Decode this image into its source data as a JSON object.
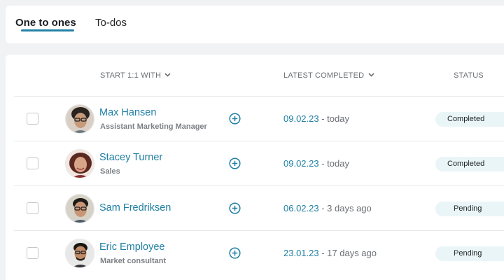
{
  "tabs": [
    {
      "label": "One to ones",
      "active": true
    },
    {
      "label": "To-dos",
      "active": false
    }
  ],
  "table": {
    "headers": {
      "start_with": "START 1:1 WITH",
      "latest_completed": "LATEST COMPLETED",
      "status": "STATUS"
    },
    "rows": [
      {
        "name": "Max Hansen",
        "role": "Assistant Marketing Manager",
        "date": "09.02.23",
        "relative": " - today",
        "status": "Completed"
      },
      {
        "name": "Stacey Turner",
        "role": "Sales",
        "date": "09.02.23",
        "relative": " - today",
        "status": "Completed"
      },
      {
        "name": "Sam Fredriksen",
        "role": "",
        "date": "06.02.23",
        "relative": " - 3 days ago",
        "status": "Pending"
      },
      {
        "name": "Eric Employee",
        "role": "Market consultant",
        "date": "23.01.23",
        "relative": " - 17 days ago",
        "status": "Pending"
      }
    ]
  },
  "colors": {
    "accent": "#2282a6",
    "link": "#1f7fa3",
    "badge_bg": "#eaf5f8"
  },
  "icons": [
    "chevron-down-icon",
    "plus-circle-icon"
  ]
}
